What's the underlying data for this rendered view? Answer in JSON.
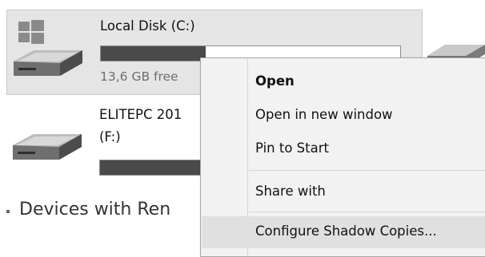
{
  "drives": [
    {
      "name": "Local Disk (C:)",
      "free_text": "13,6 GB free",
      "usage_fraction": 0.35,
      "icon": "windows-hard-drive-icon",
      "selected": true
    },
    {
      "name_line1": "ELITEPC 201",
      "name_line2": "(F:)",
      "usage_fraction": 0.85,
      "icon": "removable-drive-icon",
      "selected": false
    }
  ],
  "section": {
    "title": "Devices with Ren"
  },
  "context_menu": {
    "items": [
      {
        "label": "Open",
        "bold": true
      },
      {
        "label": "Open in new window"
      },
      {
        "label": "Pin to Start"
      },
      {
        "label": "Share with"
      },
      {
        "label": "Configure Shadow Copies..."
      }
    ]
  },
  "colors": {
    "tile_selected": "#e5e5e5",
    "bar_fill": "#4a4a4a",
    "menu_bg": "#f2f2f2"
  }
}
